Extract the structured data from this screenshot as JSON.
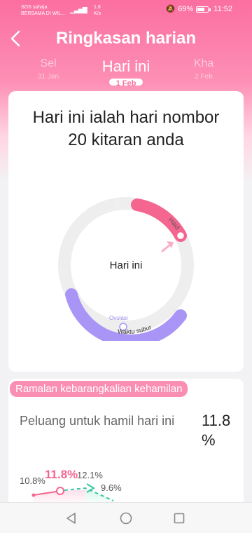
{
  "status_bar": {
    "carrier_line1": "SOS sahaja",
    "carrier_line2": "BERSAMA DI WIL...",
    "speed": "1.8\nK/s",
    "battery": "69%",
    "time": "11:52"
  },
  "header": {
    "back_icon": "chevron-left-icon",
    "title": "Ringkasan harian"
  },
  "date_tabs": [
    {
      "label": "Sel",
      "sub": "31 Jan"
    },
    {
      "label": "Hari ini",
      "sub": "1 Feb"
    },
    {
      "label": "Kha",
      "sub": "2 Feb"
    }
  ],
  "cycle": {
    "description": "Hari ini ialah hari nombor 20 kitaran anda",
    "center_label": "Hari ini",
    "period_label": "Haid",
    "ovulation_label": "Ovulasi",
    "fertile_label": "Waktu subur",
    "colors": {
      "period": "#f4668f",
      "fertile": "#a995f5",
      "track": "#eeeeee"
    }
  },
  "prediction": {
    "badge": "Ramalan kebarangkalian kehamilan",
    "label": "Peluang untuk hamil hari ini",
    "value": "11.8 %",
    "chart_points": [
      {
        "label": "10.8%",
        "value": 10.8
      },
      {
        "label": "11.8%",
        "value": 11.8,
        "highlight": true
      },
      {
        "label": "12.1%",
        "value": 12.1
      },
      {
        "label": "9.6%",
        "value": 9.6
      }
    ]
  },
  "nav": {
    "back": "triangle-back-icon",
    "home": "circle-home-icon",
    "recents": "square-recents-icon"
  }
}
